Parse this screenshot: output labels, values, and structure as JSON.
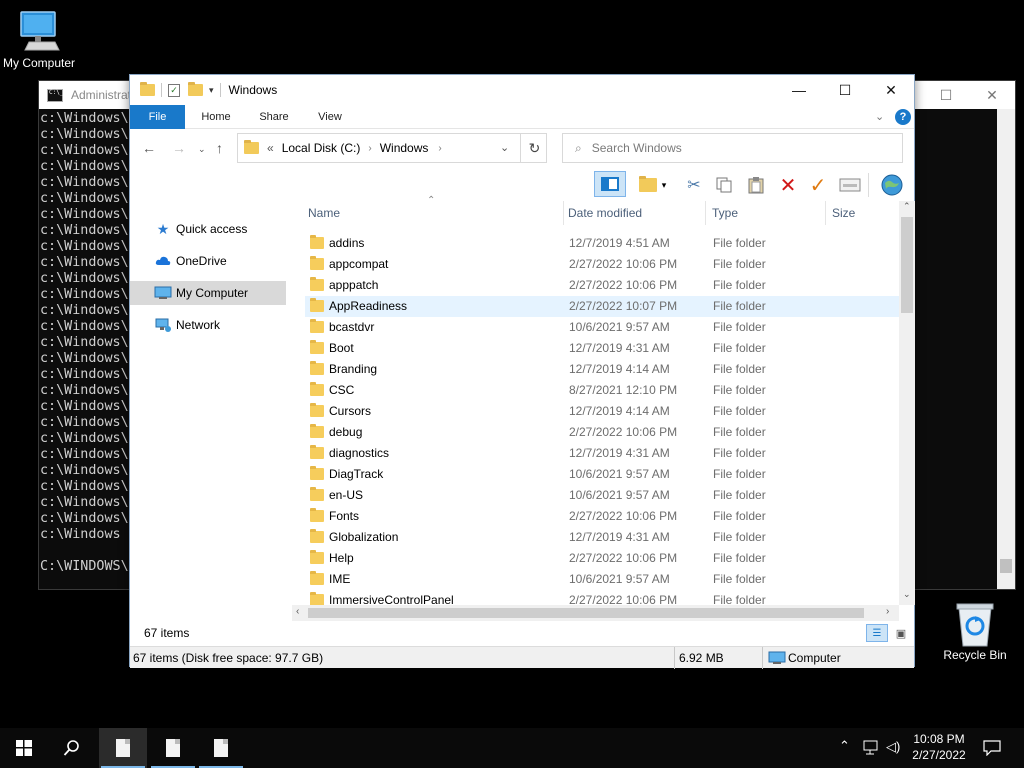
{
  "desktop": {
    "my_computer_label": "My Computer",
    "recycle_bin_label": "Recycle Bin"
  },
  "console": {
    "title": "Administrat",
    "lines": [
      "c:\\Windows\\",
      "c:\\Windows\\",
      "c:\\Windows\\",
      "c:\\Windows\\",
      "c:\\Windows\\",
      "c:\\Windows\\",
      "c:\\Windows\\",
      "c:\\Windows\\",
      "c:\\Windows\\",
      "c:\\Windows\\",
      "c:\\Windows\\",
      "c:\\Windows\\",
      "c:\\Windows\\",
      "c:\\Windows\\",
      "c:\\Windows\\",
      "c:\\Windows\\",
      "c:\\Windows\\",
      "c:\\Windows\\",
      "c:\\Windows\\",
      "c:\\Windows\\",
      "c:\\Windows\\",
      "c:\\Windows\\",
      "c:\\Windows\\",
      "c:\\Windows\\",
      "c:\\Windows\\",
      "c:\\Windows\\",
      "c:\\Windows",
      "",
      "C:\\WINDOWS\\"
    ]
  },
  "explorer": {
    "title": "Windows",
    "tabs": {
      "file": "File",
      "home": "Home",
      "share": "Share",
      "view": "View"
    },
    "address": {
      "crumb_prefix": "«",
      "crumb_1": "Local Disk (C:)",
      "crumb_2": "Windows"
    },
    "search_placeholder": "Search Windows",
    "nav": {
      "quick_access": "Quick access",
      "onedrive": "OneDrive",
      "my_computer": "My Computer",
      "network": "Network"
    },
    "columns": {
      "name": "Name",
      "date": "Date modified",
      "type": "Type",
      "size": "Size"
    },
    "files": [
      {
        "name": "addins",
        "date": "12/7/2019 4:51 AM",
        "type": "File folder"
      },
      {
        "name": "appcompat",
        "date": "2/27/2022 10:06 PM",
        "type": "File folder"
      },
      {
        "name": "apppatch",
        "date": "2/27/2022 10:06 PM",
        "type": "File folder"
      },
      {
        "name": "AppReadiness",
        "date": "2/27/2022 10:07 PM",
        "type": "File folder"
      },
      {
        "name": "bcastdvr",
        "date": "10/6/2021 9:57 AM",
        "type": "File folder"
      },
      {
        "name": "Boot",
        "date": "12/7/2019 4:31 AM",
        "type": "File folder"
      },
      {
        "name": "Branding",
        "date": "12/7/2019 4:14 AM",
        "type": "File folder"
      },
      {
        "name": "CSC",
        "date": "8/27/2021 12:10 PM",
        "type": "File folder"
      },
      {
        "name": "Cursors",
        "date": "12/7/2019 4:14 AM",
        "type": "File folder"
      },
      {
        "name": "debug",
        "date": "2/27/2022 10:06 PM",
        "type": "File folder"
      },
      {
        "name": "diagnostics",
        "date": "12/7/2019 4:31 AM",
        "type": "File folder"
      },
      {
        "name": "DiagTrack",
        "date": "10/6/2021 9:57 AM",
        "type": "File folder"
      },
      {
        "name": "en-US",
        "date": "10/6/2021 9:57 AM",
        "type": "File folder"
      },
      {
        "name": "Fonts",
        "date": "2/27/2022 10:06 PM",
        "type": "File folder"
      },
      {
        "name": "Globalization",
        "date": "12/7/2019 4:31 AM",
        "type": "File folder"
      },
      {
        "name": "Help",
        "date": "2/27/2022 10:06 PM",
        "type": "File folder"
      },
      {
        "name": "IME",
        "date": "10/6/2021 9:57 AM",
        "type": "File folder"
      },
      {
        "name": "ImmersiveControlPanel",
        "date": "2/27/2022 10:06 PM",
        "type": "File folder"
      }
    ],
    "hover_row": "AppReadiness",
    "item_count": "67 items",
    "status": {
      "left": "67 items (Disk free space: 97.7 GB)",
      "size": "6.92 MB",
      "location": "Computer"
    }
  },
  "taskbar": {
    "time": "10:08 PM",
    "date": "2/27/2022"
  },
  "colors": {
    "accent": "#1979ca",
    "folder": "#f6cd5c",
    "hover_row": "#e5f3ff",
    "selected_nav": "#d9d9d9"
  }
}
